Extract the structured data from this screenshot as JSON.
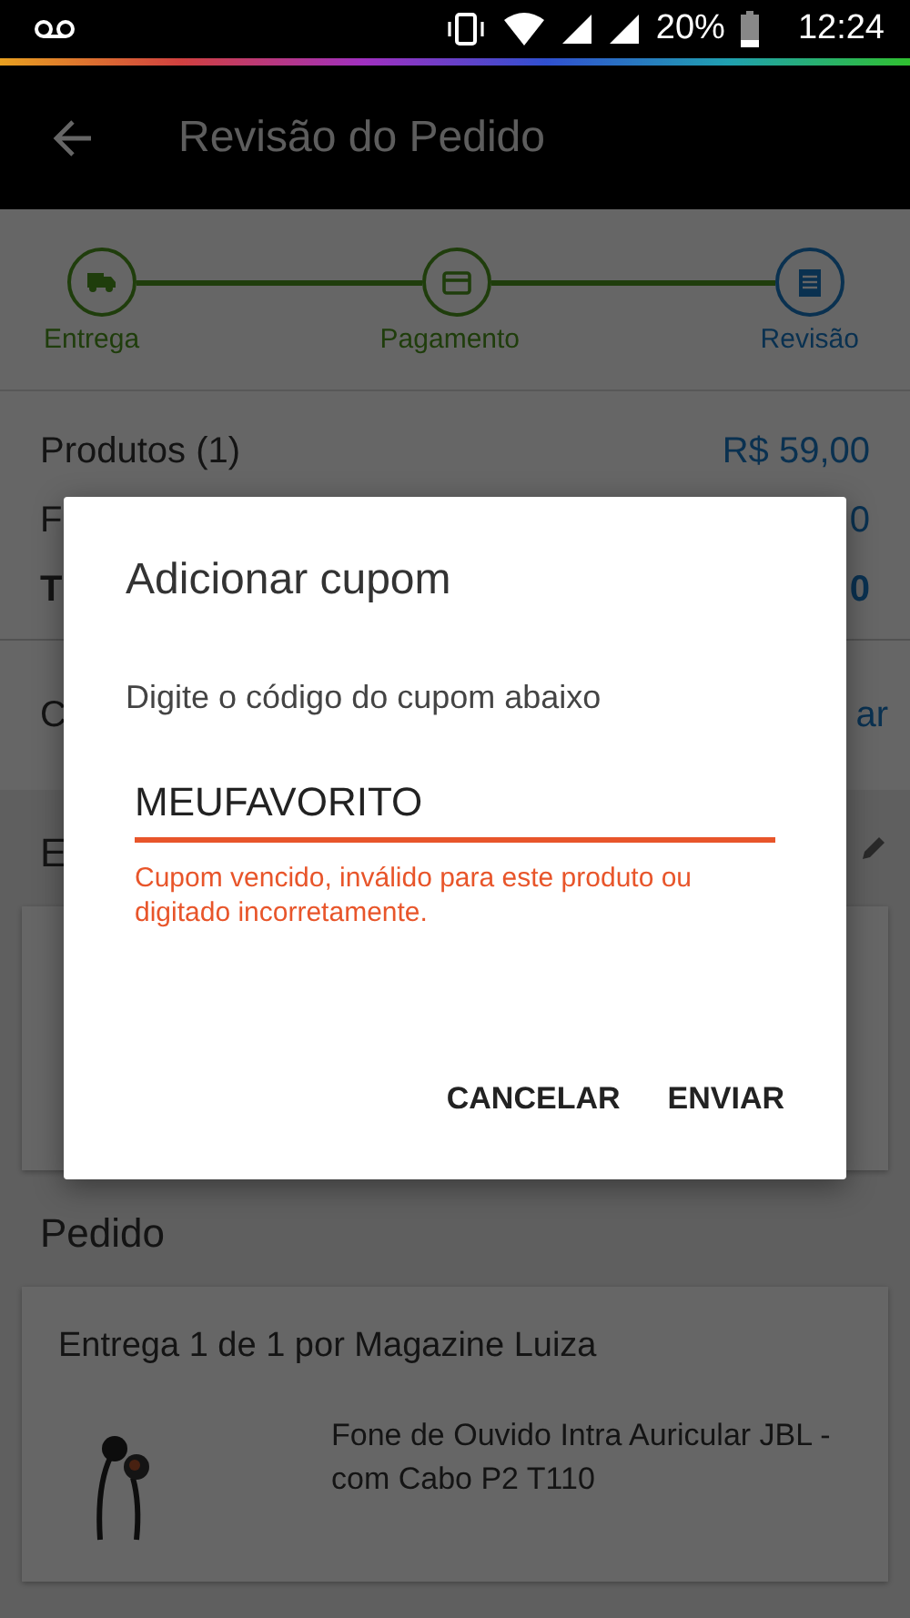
{
  "status_bar": {
    "battery": "20%",
    "time": "12:24"
  },
  "app_bar": {
    "title": "Revisão do Pedido"
  },
  "steps": [
    {
      "label": "Entrega",
      "selected": false
    },
    {
      "label": "Pagamento",
      "selected": false
    },
    {
      "label": "Revisão",
      "selected": true
    }
  ],
  "summary": [
    {
      "label": "Produtos (1)",
      "value": "R$ 59,00",
      "kind": "line"
    },
    {
      "label": "F",
      "value": "0",
      "kind": "line"
    },
    {
      "label": "T",
      "value": "0",
      "kind": "total"
    }
  ],
  "coupon_row": {
    "label": "C",
    "action": "ar"
  },
  "address_section": {
    "heading": "E"
  },
  "order_section": {
    "heading": "Pedido",
    "delivery": "Entrega 1 de 1 por Magazine Luiza",
    "product": "Fone de Ouvido Intra Auricular JBL - com Cabo P2 T110"
  },
  "dialog": {
    "title": "Adicionar cupom",
    "message": "Digite o código do cupom abaixo",
    "field": {
      "value": "MEUFAVORITO",
      "error": "Cupom vencido, inválido para este produto ou digitado incorretamente."
    },
    "buttons": [
      "CANCELAR",
      "ENVIAR"
    ]
  }
}
